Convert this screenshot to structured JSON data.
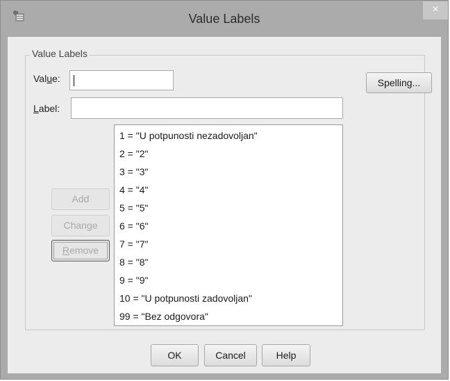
{
  "window": {
    "title": "Value Labels",
    "close_glyph": "×",
    "app_icon": "spss-value-labels-icon"
  },
  "group": {
    "legend": "Value Labels"
  },
  "value_field": {
    "label_pre": "Val",
    "label_key": "u",
    "label_post": "e:",
    "value": ""
  },
  "label_field": {
    "label_key": "L",
    "label_post": "abel:",
    "value": ""
  },
  "buttons": {
    "spelling": "Spelling...",
    "add": "Add",
    "change": "Change",
    "remove_pre": "",
    "remove_key": "R",
    "remove_post": "emove",
    "ok": "OK",
    "cancel": "Cancel",
    "help": "Help"
  },
  "labels_list": [
    "1 = \"U potpunosti nezadovoljan\"",
    "2 = \"2\"",
    "3 = \"3\"",
    "4 = \"4\"",
    "5 = \"5\"",
    "6 = \"6\"",
    "7 = \"7\"",
    "8 = \"8\"",
    "9 = \"9\"",
    "10 = \"U potpunosti zadovoljan\"",
    "99 = \"Bez odgovora\""
  ]
}
